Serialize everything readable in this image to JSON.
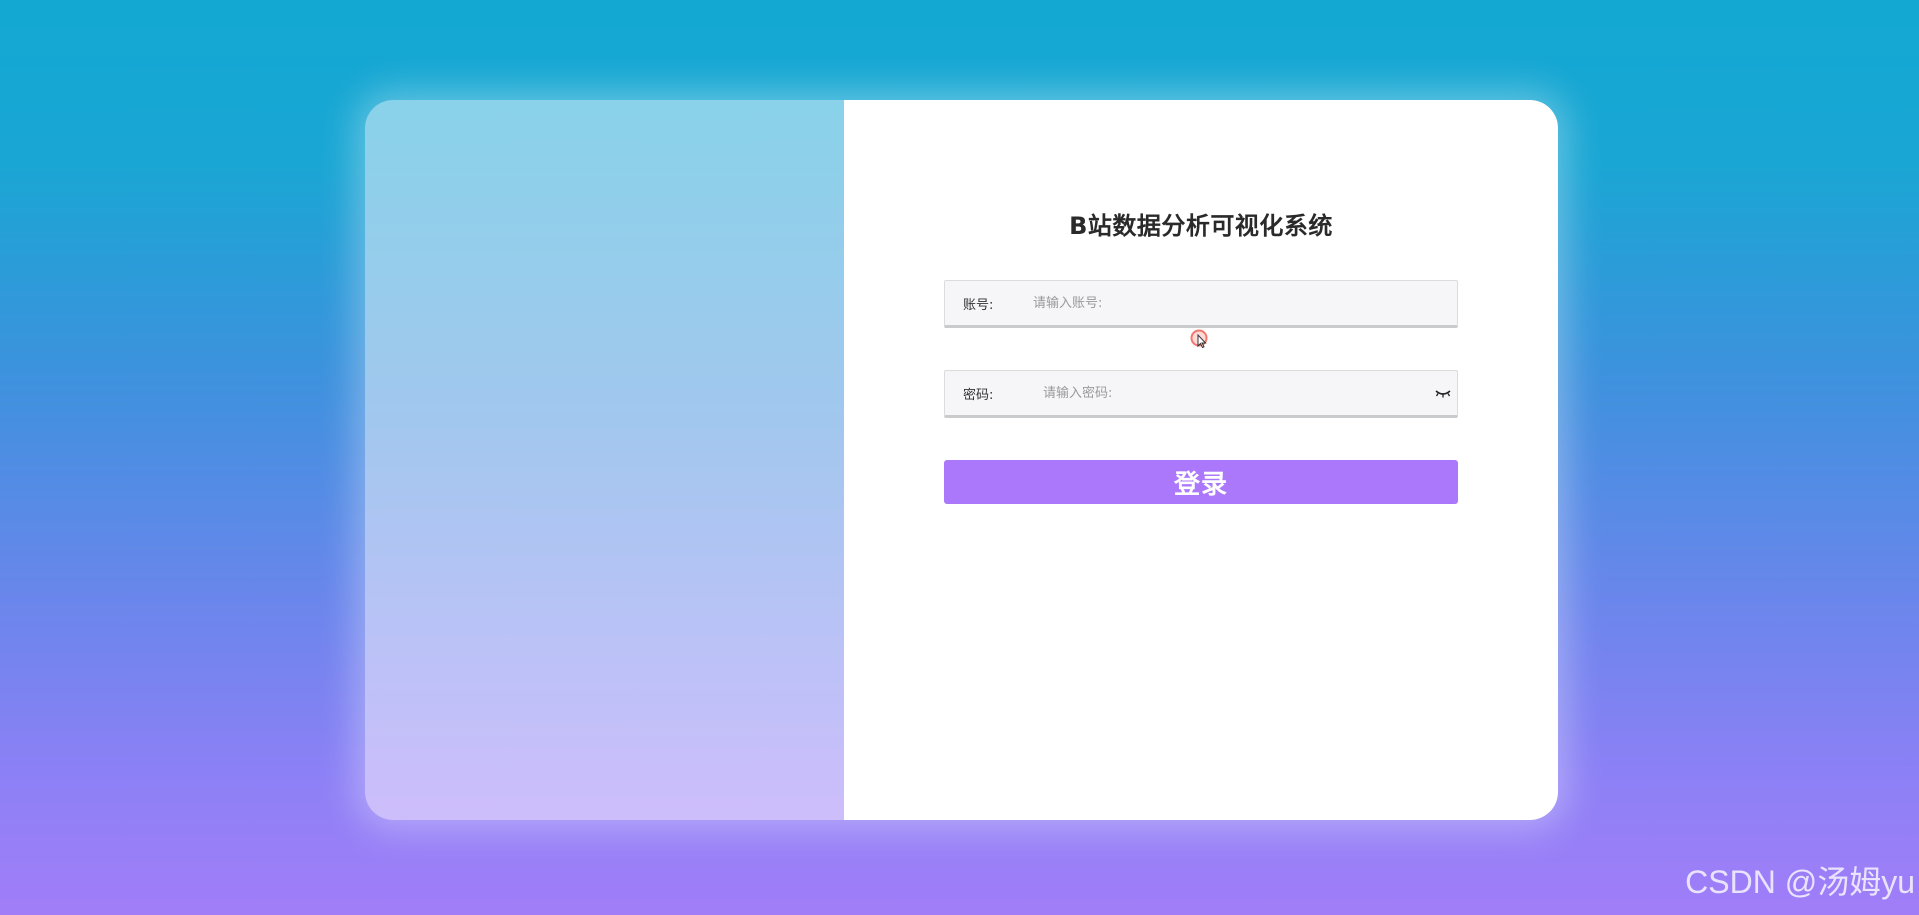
{
  "login": {
    "title": "B站数据分析可视化系统",
    "username_label": "账号:",
    "username_placeholder": "请输入账号:",
    "username_value": "",
    "password_label": "密码:",
    "password_placeholder": "请输入密码:",
    "password_value": "",
    "password_toggle_icon": "eye-closed-icon",
    "submit_label": "登录"
  },
  "watermark": {
    "text": "CSDN @汤姆yu"
  },
  "colors": {
    "background_top": "#12a8d2",
    "background_bottom": "#a17ef8",
    "left_panel_top": "#89d2e9",
    "left_panel_bottom": "#cdbdfb",
    "button": "#ab78fb",
    "field_background": "#f6f5f7",
    "title_text": "#2a2a2a"
  }
}
